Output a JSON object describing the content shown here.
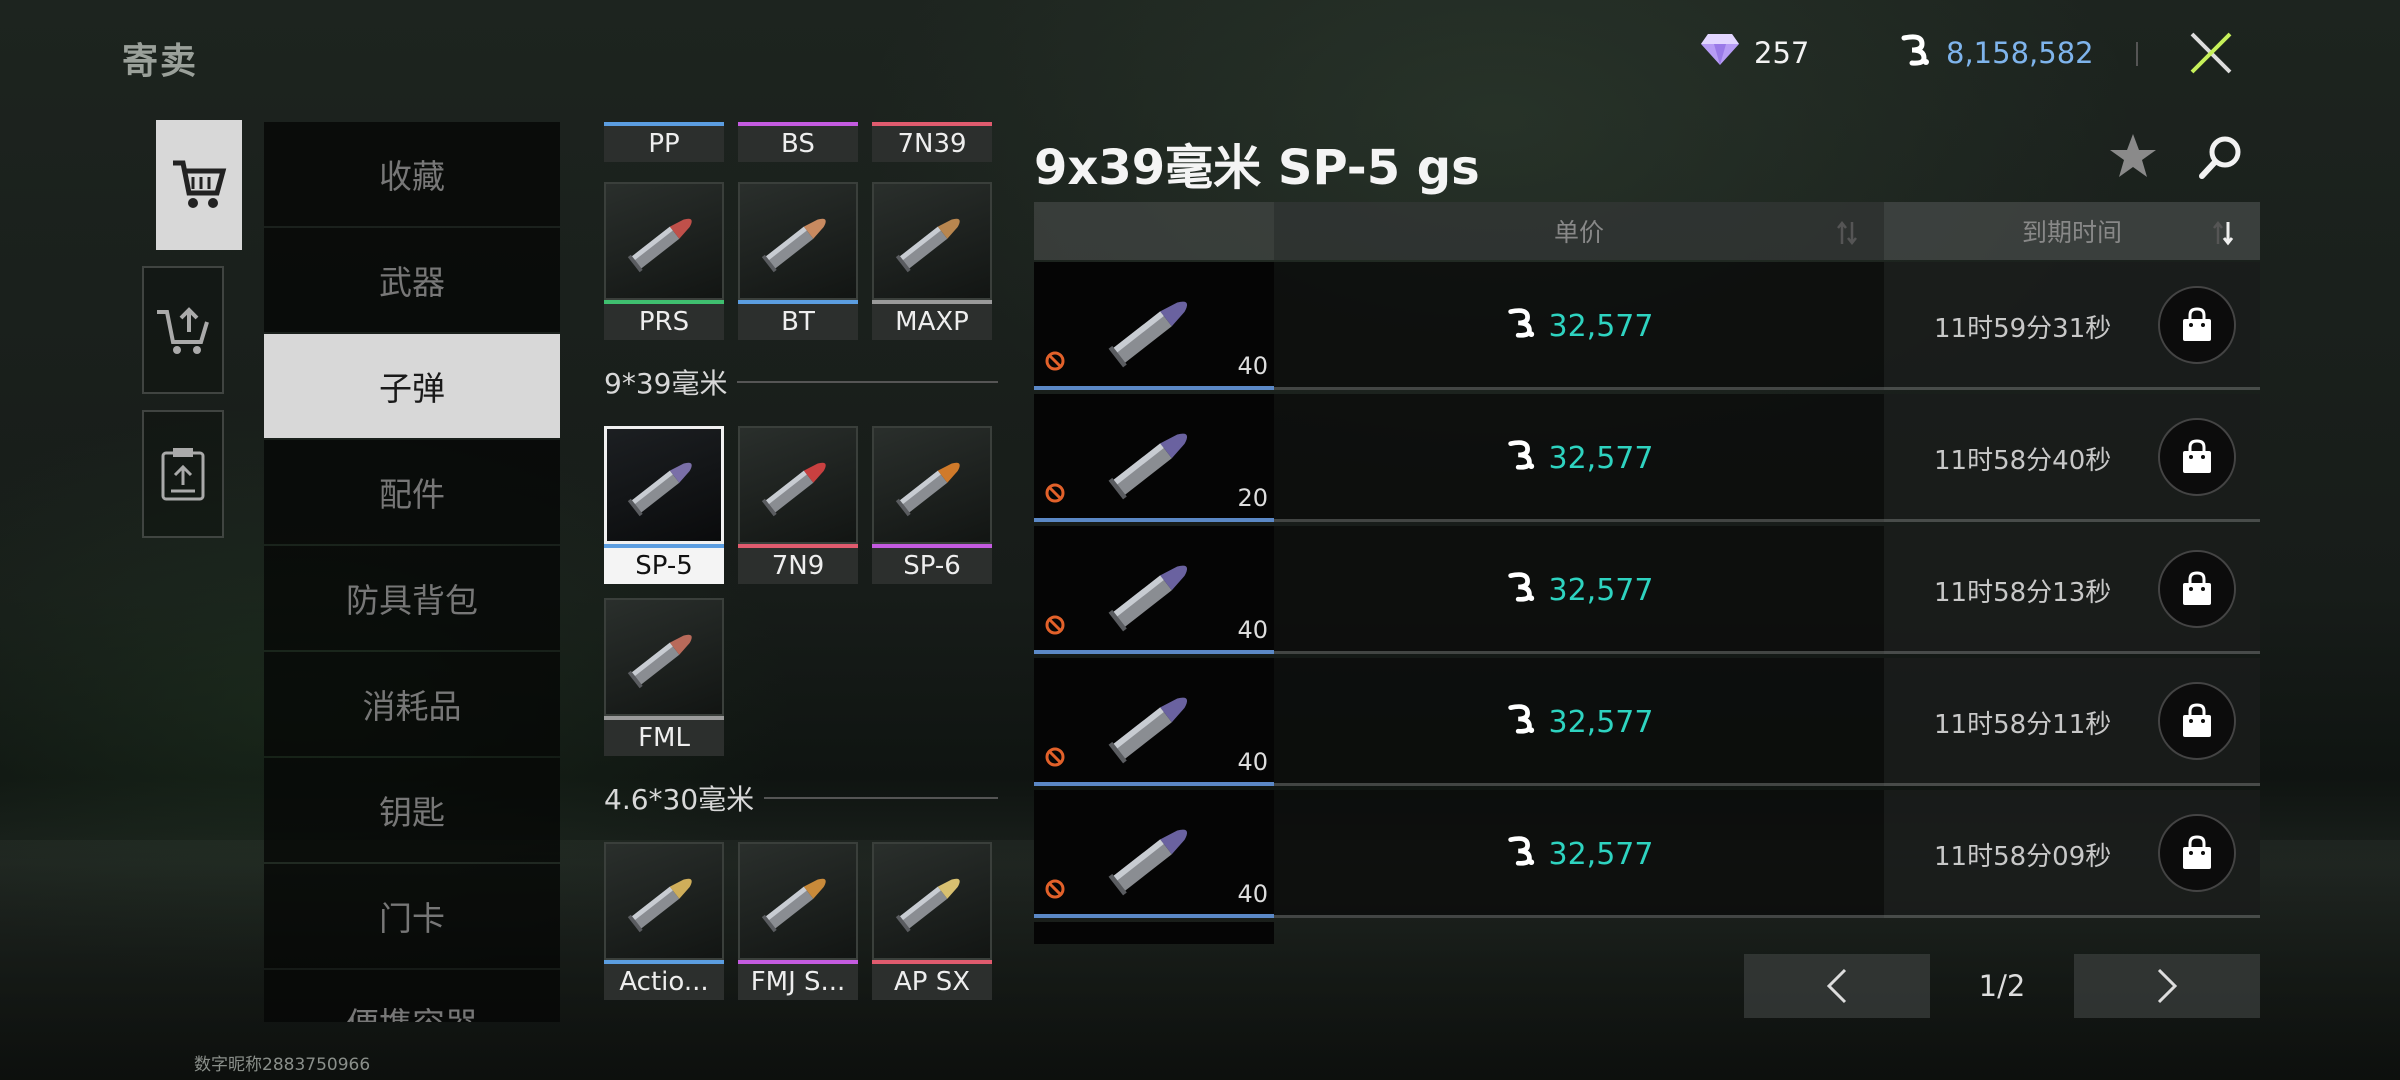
{
  "header": {
    "title": "寄卖",
    "gems": "257",
    "coins": "8,158,582"
  },
  "categories": [
    {
      "label": "收藏",
      "active": false
    },
    {
      "label": "武器",
      "active": false
    },
    {
      "label": "子弹",
      "active": true
    },
    {
      "label": "配件",
      "active": false
    },
    {
      "label": "防具背包",
      "active": false
    },
    {
      "label": "消耗品",
      "active": false
    },
    {
      "label": "钥匙",
      "active": false
    },
    {
      "label": "门卡",
      "active": false
    },
    {
      "label": "便携容器",
      "active": false
    }
  ],
  "ammo": {
    "top_row": [
      {
        "label": "PP",
        "rarity": "#5b9de0"
      },
      {
        "label": "BS",
        "rarity": "#c45be0"
      },
      {
        "label": "7N39",
        "rarity": "#e05b6e"
      }
    ],
    "row2": [
      {
        "label": "PRS",
        "rarity": "#3fbf6f",
        "tip": "#c0504a"
      },
      {
        "label": "BT",
        "rarity": "#5b9de0",
        "tip": "#c88a60"
      },
      {
        "label": "MAXP",
        "rarity": "#9a9a9a",
        "tip": "#b8864f"
      }
    ],
    "section_939": "9*39毫米",
    "items_939": [
      {
        "label": "SP-5",
        "rarity": "#5b9de0",
        "tip": "#7a6fa8",
        "selected": true
      },
      {
        "label": "7N9",
        "rarity": "#e05b6e",
        "tip": "#c94040",
        "selected": false
      },
      {
        "label": "SP-6",
        "rarity": "#c45be0",
        "tip": "#d07a2a",
        "selected": false
      },
      {
        "label": "FML",
        "rarity": "#9a9a9a",
        "tip": "#b86a5a",
        "selected": false
      }
    ],
    "section_4630": "4.6*30毫米",
    "items_4630": [
      {
        "label": "Actio...",
        "rarity": "#5b9de0",
        "tip": "#cfae5a"
      },
      {
        "label": "FMJ S...",
        "rarity": "#c45be0",
        "tip": "#c98a3a"
      },
      {
        "label": "AP SX",
        "rarity": "#e05b6e",
        "tip": "#d8c070"
      }
    ]
  },
  "listing": {
    "title": "9x39毫米 SP-5 gs",
    "col_price": "单价",
    "col_time": "到期时间",
    "rows": [
      {
        "qty": "40",
        "price": "32,577",
        "time": "11时59分31秒"
      },
      {
        "qty": "20",
        "price": "32,577",
        "time": "11时58分40秒"
      },
      {
        "qty": "40",
        "price": "32,577",
        "time": "11时58分13秒"
      },
      {
        "qty": "40",
        "price": "32,577",
        "time": "11时58分11秒"
      },
      {
        "qty": "40",
        "price": "32,577",
        "time": "11时58分09秒"
      }
    ]
  },
  "pager": {
    "page": "1/2"
  },
  "footer": {
    "user_id": "数字昵称2883750966"
  },
  "colors": {
    "price": "#2ed3c0",
    "coin_total": "#7fb4ec",
    "gem": "#c9a8ff"
  }
}
